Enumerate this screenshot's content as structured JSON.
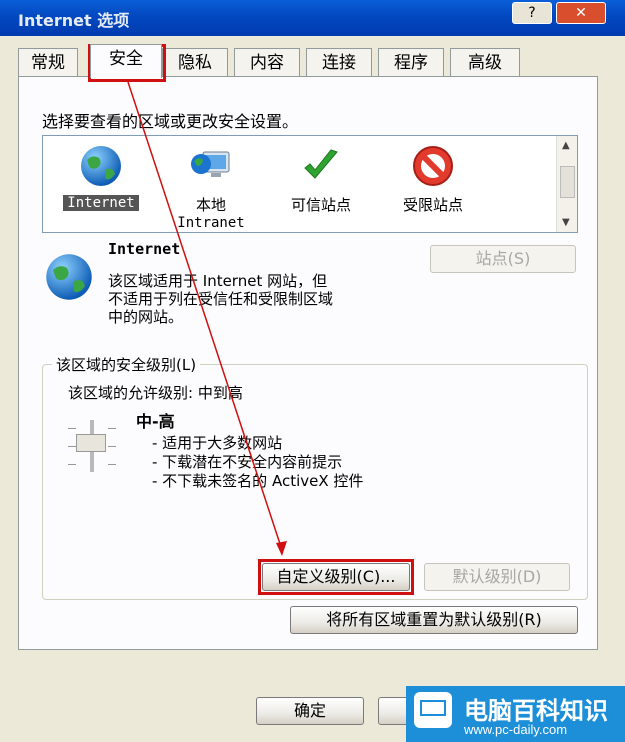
{
  "window": {
    "title": "Internet 选项",
    "help_label": "?",
    "close_label": "✕"
  },
  "tabs": [
    "常规",
    "安全",
    "隐私",
    "内容",
    "连接",
    "程序",
    "高级"
  ],
  "active_tab": "安全",
  "security": {
    "prompt": "选择要查看的区域或更改安全设置。",
    "zones": [
      {
        "name": "Internet",
        "icon": "globe-icon"
      },
      {
        "name": "本地",
        "sub": "Intranet",
        "icon": "computer-globe-icon"
      },
      {
        "name": "可信站点",
        "icon": "green-check-icon"
      },
      {
        "name": "受限站点",
        "icon": "no-entry-icon"
      }
    ],
    "selected_zone": {
      "name": "Internet",
      "desc_line1": "该区域适用于 Internet 网站，但",
      "desc_line2": "不适用于列在受信任和受限制区域",
      "desc_line3": "中的网站。"
    },
    "sites_button": "站点(S)",
    "level_group_label": "该区域的安全级别(L)",
    "allowed_levels": "该区域的允许级别: 中到高",
    "level_name": "中-高",
    "level_bullets": [
      "- 适用于大多数网站",
      "- 下载潜在不安全内容前提示",
      "- 不下载未签名的 ActiveX 控件"
    ],
    "custom_level_button": "自定义级别(C)...",
    "default_level_button": "默认级别(D)",
    "reset_all_button": "将所有区域重置为默认级别(R)"
  },
  "footer": {
    "ok_label": "确定"
  },
  "watermark": {
    "title": "电脑百科知识",
    "url": "www.pc-daily.com"
  },
  "colors": {
    "highlight": "#D01010",
    "titlebar": "#0348C0",
    "watermark": "#1C8FD8"
  }
}
